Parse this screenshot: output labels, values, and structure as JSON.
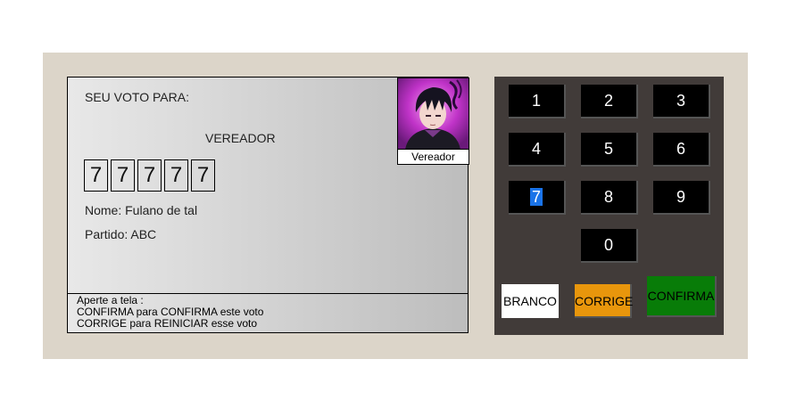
{
  "screen": {
    "vote_for": "SEU VOTO PARA:",
    "role": "VEREADOR",
    "digits": [
      "7",
      "7",
      "7",
      "7",
      "7"
    ],
    "name": "Nome: Fulano de tal",
    "party": "Partido: ABC",
    "photo_label": "Vereador",
    "instructions": [
      "Aperte a tela :",
      "CONFIRMA para CONFIRMA este voto",
      "CORRIGE para REINICIAR esse voto"
    ]
  },
  "keypad": {
    "keys": [
      "1",
      "2",
      "3",
      "4",
      "5",
      "6",
      "7",
      "8",
      "9",
      "0"
    ],
    "selected_key": "7",
    "branco": "BRANCO",
    "corrige": "CORRIGE",
    "confirma": "CONFIRMA"
  },
  "colors": {
    "machine_bg": "#dcd5c9",
    "keypad_bg": "#413b39",
    "corrige": "#e8960c",
    "confirma": "#087c08",
    "selection": "#1a73e8"
  }
}
